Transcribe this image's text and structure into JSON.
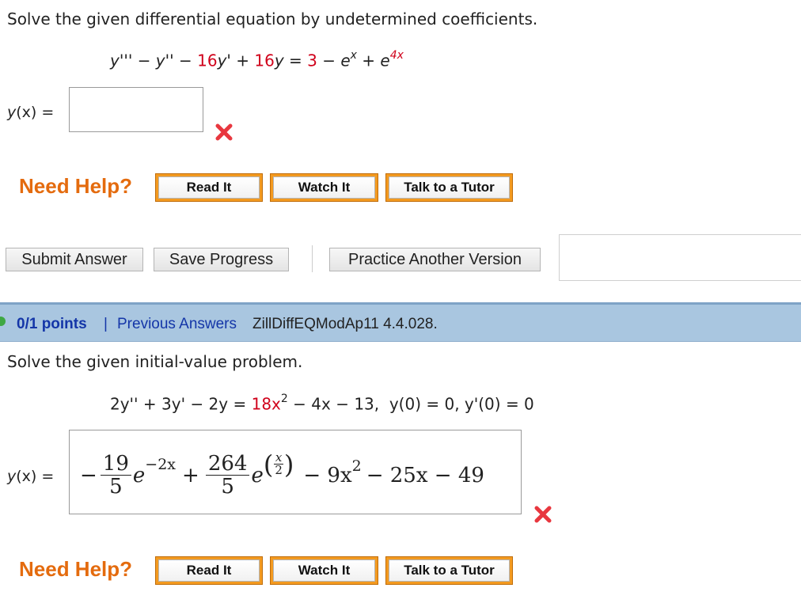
{
  "question1": {
    "prompt": "Solve the given differential equation by undetermined coefficients.",
    "equation": {
      "lhs_a": "y''' − y'' − ",
      "c1": "16",
      "lhs_b": "y' + ",
      "c2": "16",
      "lhs_c": "y = ",
      "r1": "3",
      "mid": " − e",
      "exp1": "x",
      "plus": " + e",
      "exp2": "4x"
    },
    "answer_label_y": "y",
    "answer_label_x": "(x) =",
    "answer_value": "",
    "result": "incorrect"
  },
  "help1": {
    "label": "Need Help?",
    "read_it": "Read It",
    "watch_it": "Watch It",
    "talk_tutor": "Talk to a Tutor"
  },
  "actions": {
    "submit": "Submit Answer",
    "save": "Save Progress",
    "practice": "Practice Another Version"
  },
  "question2_header": {
    "points": "0/1 points",
    "separator": "|",
    "previous_answers": "Previous Answers",
    "code": "ZillDiffEQModAp11 4.4.028."
  },
  "question2": {
    "prompt": "Solve the given initial-value problem.",
    "equation": {
      "lhs": "2y'' + 3y' − 2y = ",
      "r1": "18x",
      "r1_exp": "2",
      "r2": " − 4x − 13,",
      "ic": "y(0) = 0, y'(0) = 0"
    },
    "answer_label_y": "y",
    "answer_label_x": "(x) =",
    "answer": {
      "t1_sign": "−",
      "t1_num": "19",
      "t1_den": "5",
      "t1_e": "e",
      "t1_exp": "−2x",
      "plus": "+",
      "t2_num": "264",
      "t2_den": "5",
      "t2_e": "e",
      "t2_exp_num": "x",
      "t2_exp_den": "2",
      "rest_a": "− 9x",
      "rest_exp": "2",
      "rest_b": "− 25x − 49"
    },
    "result": "incorrect"
  },
  "help2": {
    "label": "Need Help?",
    "read_it": "Read It",
    "watch_it": "Watch It",
    "talk_tutor": "Talk to a Tutor"
  },
  "colors": {
    "accent_red": "#d0021b",
    "help_orange": "#e46b0e",
    "header_blue": "#a9c6e0",
    "link_blue": "#1436a8"
  }
}
